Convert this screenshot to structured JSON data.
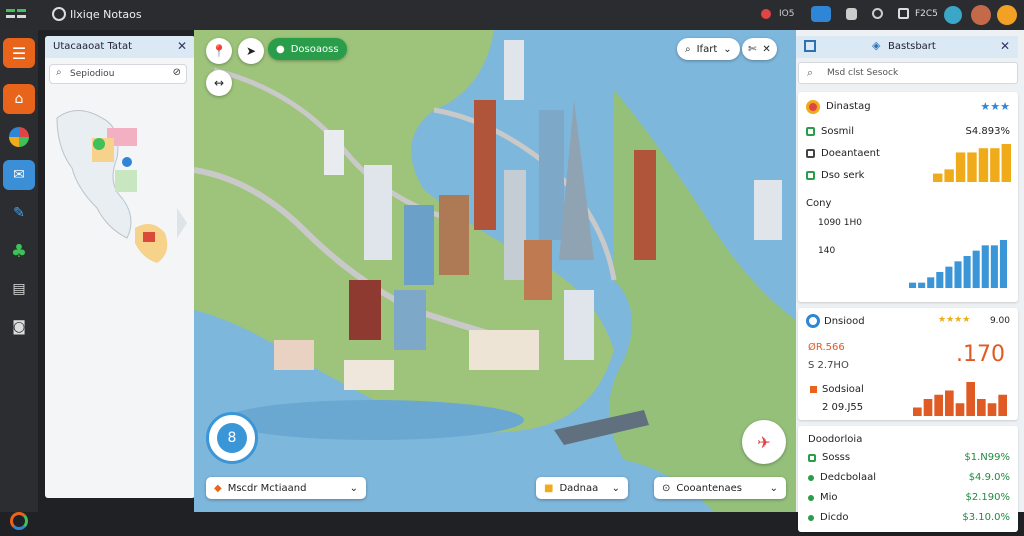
{
  "app": {
    "title": "Ilxiqe Notaos",
    "status_text": "IO5",
    "time_text": "F2C5"
  },
  "filter_panel": {
    "title": "Utacaaoat Tatat",
    "search_placeholder": "Sepiodiou"
  },
  "map_controls": {
    "location_chip": "Dosoaoss",
    "layers_button": "Ifart",
    "map_info": "8",
    "region_select": "Mscdr Mctiaand",
    "place_select": "Dadnaa",
    "search_select": "Cooantenaes"
  },
  "right_panel": {
    "title": "Bastsbart",
    "search_placeholder": "Msd clst Sesock",
    "card1": {
      "title": "Dinastag",
      "rating": "★★★",
      "rows": [
        {
          "label": "Sosmil",
          "value": "S4.893%"
        },
        {
          "label": "Doeantaent"
        },
        {
          "label": "Dso serk"
        }
      ],
      "chart_values": [
        2,
        3,
        7,
        7,
        8,
        8,
        9
      ],
      "color": "#f0ab1a"
    },
    "card2": {
      "section": "Cony",
      "rows": [
        {
          "label": "1090 1H0"
        },
        {
          "label": "140"
        }
      ],
      "chart_values": [
        1,
        1,
        2,
        3,
        4,
        5,
        6,
        7,
        8,
        8,
        9
      ],
      "color": "#3a96d6"
    },
    "card3": {
      "title": "Dnsiood",
      "rating": "★★★★",
      "rating_value": "9.00",
      "rows": [
        {
          "label": "ØR.566"
        },
        {
          "label": "S 2.7HO"
        },
        {
          "label": "Sodsioal"
        },
        {
          "label": "2 09.J55"
        }
      ],
      "big_value": ".170",
      "chart_values": [
        2,
        4,
        5,
        6,
        3,
        8,
        4,
        3,
        5
      ],
      "color": "#e05a24"
    },
    "list": {
      "title": "Doodorloia",
      "items": [
        {
          "label": "Sosss",
          "value": "$1.N99%"
        },
        {
          "label": "Dedcbolaal",
          "value": "$4.9.0%"
        },
        {
          "label": "Mio",
          "value": "$2.190%"
        },
        {
          "label": "Dicdo",
          "value": "$3.10.0%"
        }
      ]
    }
  },
  "colors": {
    "accent": "#e9641b",
    "water": "#7eb7dc",
    "green": "#2a9d4a"
  },
  "icons": [
    "settings-icon",
    "home-icon",
    "chart-icon",
    "chat-icon",
    "tools-icon",
    "clover-icon",
    "grid-icon",
    "user-icon",
    "globe-icon"
  ]
}
